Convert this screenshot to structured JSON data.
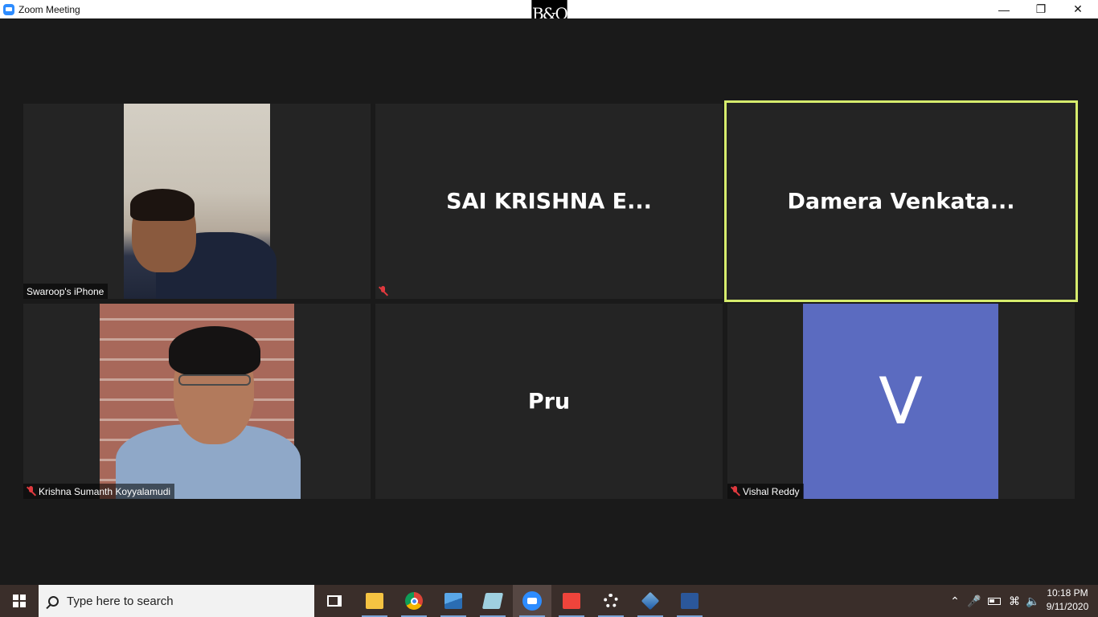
{
  "window": {
    "title": "Zoom Meeting",
    "minimize_glyph": "—",
    "restore_glyph": "❐",
    "close_glyph": "✕",
    "brand_logo_text": "B&O"
  },
  "participants": [
    {
      "id": "swaroop",
      "label": "Swaroop's iPhone",
      "muted": false,
      "video": true
    },
    {
      "id": "sai",
      "display_name": "SAI KRISHNA E...",
      "muted": true,
      "video": false
    },
    {
      "id": "damera",
      "display_name": "Damera  Venkata...",
      "muted": false,
      "video": false,
      "active_speaker": true
    },
    {
      "id": "krishna",
      "label": "Krishna Sumanth Koyyalamudi",
      "muted": true,
      "video": true
    },
    {
      "id": "pru",
      "display_name": "Pru",
      "muted": false,
      "video": false
    },
    {
      "id": "vishal",
      "label": "Vishal Reddy",
      "avatar_letter": "V",
      "muted": true,
      "video": false
    }
  ],
  "colors": {
    "active_speaker_border": "#d6ec6d",
    "avatar_bg": "#5b6bc0",
    "muted_icon": "#e0393e"
  },
  "taskbar": {
    "search_placeholder": "Type here to search",
    "apps": [
      "task-view",
      "file-explorer",
      "chrome",
      "photos",
      "notepad",
      "zoom",
      "anydesk",
      "settings",
      "virtualbox",
      "word"
    ],
    "clock_time": "10:18 PM",
    "clock_date": "9/11/2020"
  }
}
